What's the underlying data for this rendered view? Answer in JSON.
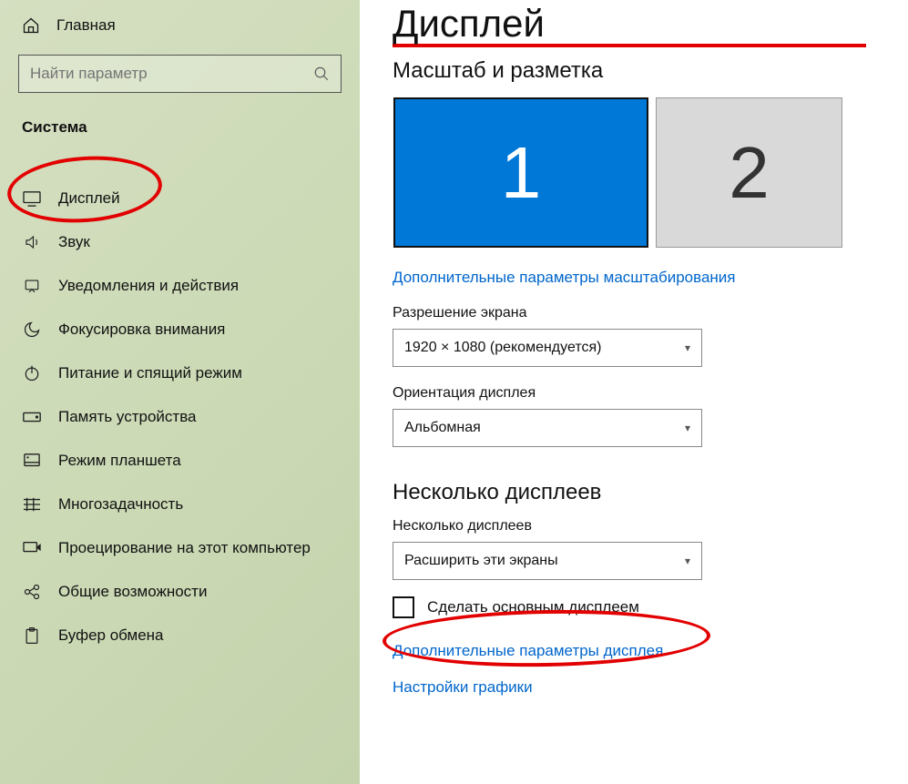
{
  "sidebar": {
    "home_label": "Главная",
    "search_placeholder": "Найти параметр",
    "section_label": "Система",
    "items": [
      {
        "label": "Дисплей",
        "icon": "display"
      },
      {
        "label": "Звук",
        "icon": "sound"
      },
      {
        "label": "Уведомления и действия",
        "icon": "notifications"
      },
      {
        "label": "Фокусировка внимания",
        "icon": "focus"
      },
      {
        "label": "Питание и спящий режим",
        "icon": "power"
      },
      {
        "label": "Память устройства",
        "icon": "storage"
      },
      {
        "label": "Режим планшета",
        "icon": "tablet"
      },
      {
        "label": "Многозадачность",
        "icon": "multitask"
      },
      {
        "label": "Проецирование на этот компьютер",
        "icon": "project"
      },
      {
        "label": "Общие возможности",
        "icon": "shared"
      },
      {
        "label": "Буфер обмена",
        "icon": "clipboard"
      }
    ]
  },
  "main": {
    "page_title": "Дисплей",
    "scale_section": "Масштаб и разметка",
    "monitors": {
      "primary": "1",
      "secondary": "2"
    },
    "adv_scaling_link": "Дополнительные параметры масштабирования",
    "resolution_label": "Разрешение экрана",
    "resolution_value": "1920 × 1080 (рекомендуется)",
    "orientation_label": "Ориентация дисплея",
    "orientation_value": "Альбомная",
    "multi_section": "Несколько дисплеев",
    "multi_label": "Несколько дисплеев",
    "multi_value": "Расширить эти экраны",
    "make_primary_label": "Сделать основным дисплеем",
    "adv_display_link": "Дополнительные параметры дисплея",
    "graphics_link": "Настройки графики"
  }
}
